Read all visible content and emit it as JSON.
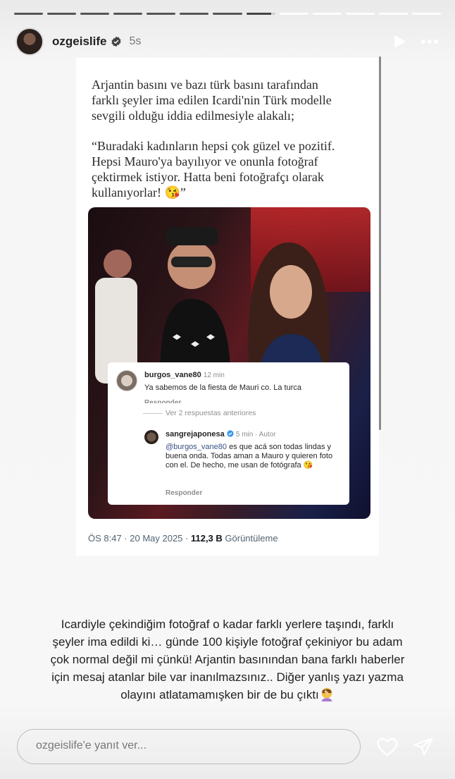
{
  "story": {
    "progress_segments": 13,
    "progress_completed": 7,
    "progress_current": 0.85
  },
  "header": {
    "username": "ozgeislife",
    "time": "5s",
    "verified": true,
    "play_icon": "play-icon",
    "more_icon": "more-icon"
  },
  "card": {
    "quote1": "Arjantin basını ve bazı türk basını tarafından\nfarklı şeyler ima edilen Icardi'nin Türk modelle\nsevgili olduğu iddia edilmesiyle alakalı;",
    "quote2": "“Buradaki kadınların hepsi çok güzel ve pozitif.\nHepsi Mauro'ya bayılıyor ve onunla fotoğraf\nçektirmek istiyor. Hatta beni fotoğrafçı olarak\nkullanıyorlar! 😘”",
    "comment1": {
      "user": "burgos_vane80",
      "meta": "12 min",
      "text": "Ya sabemos de la fiesta de Mauri co. La turca",
      "reply": "Responder"
    },
    "more_replies": "Ver 2 respuestas anteriores",
    "comment2": {
      "user": "sangrejaponesa",
      "meta": "5 min · Autor",
      "mention": "@burgos_vane80",
      "text": " es que acá son todas lindas y buena onda. Todas aman a Mauro y quieren foto con el. De hecho, me usan de fotógrafa 😘",
      "reply": "Responder"
    },
    "tweet_time": "ÖS 8:47 · 20 May 2025 · ",
    "views_count": "112,3 B",
    "views_label": " Görüntüleme"
  },
  "caption": {
    "text": "Icardiyle çekindiğim fotoğraf o kadar farklı yerlere taşındı, farklı şeyler ima edildi ki… günde 100 kişiyle fotoğraf çekiniyor bu adam çok normal değil mi çünkü! Arjantin basınından bana farklı haberler için mesaj atanlar bile var inanılmazsınız.. Diğer yanlış yazı yazma olayını atlatamamışken bir de bu çıktı",
    "emoji": "facepalm-emoji"
  },
  "reply_bar": {
    "placeholder": "ozgeislife'e yanıt ver...",
    "like_icon": "heart-icon",
    "send_icon": "send-icon"
  }
}
